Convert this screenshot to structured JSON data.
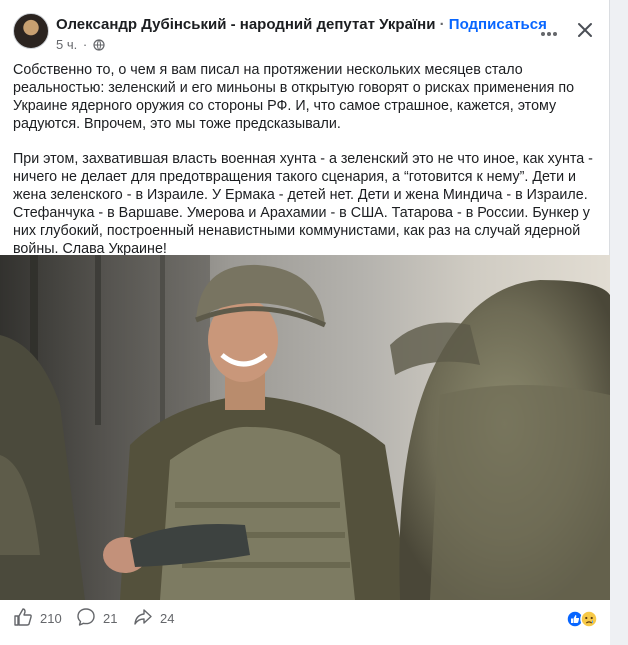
{
  "post": {
    "author": "Олександр Дубінський - народний депутат України",
    "separator": "·",
    "subscribe_label": "Подписаться",
    "time_ago": "5 ч.",
    "meta_dot": "·",
    "paragraphs": [
      "Собственно то, о чем я вам писал на протяжении нескольких месяцев  стало реальностью: зеленский и его миньоны в открытую говорят о рисках применения по Украине ядерного оружия со стороны РФ. И, что самое страшное, кажется, этому радуются. Впрочем, это мы тоже предсказывали.",
      "При этом, захватившая власть военная хунта - а зеленский это не что иное, как хунта - ничего не делает для предотвращения такого сценария, а “готовится к нему”. Дети и жена зеленского - в Израиле. У  Ермака - детей нет. Дети и жена Миндича - в Израиле. Стефанчука - в Варшаве. Умерова и Арахамии - в США. Татарова - в России. Бункер у них глубокий, построенный ненавистными коммунистами, как раз на случай ядерной войны.  Слава Украине!"
    ]
  },
  "stats": {
    "likes": "210",
    "comments": "21",
    "shares": "24"
  },
  "icons": {
    "more": "more-horizontal-icon",
    "close": "close-icon",
    "privacy": "globe-icon",
    "like": "thumbs-up-icon",
    "comment": "comment-icon",
    "share": "share-icon"
  },
  "colors": {
    "accent": "#0866ff",
    "secondary_text": "#65676b"
  }
}
